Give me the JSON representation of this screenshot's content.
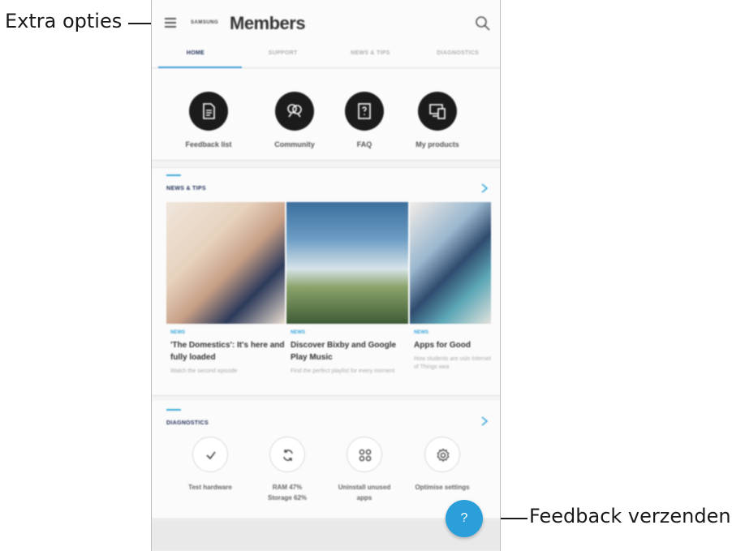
{
  "callouts": {
    "menu_label": "Extra opties",
    "feedback_label": "Feedback verzenden."
  },
  "header": {
    "brand_small": "SAMSUNG",
    "brand": "Members",
    "menu_icon": "hamburger-menu-icon",
    "search_icon": "search-icon"
  },
  "tabs": [
    {
      "label": "HOME",
      "active": true
    },
    {
      "label": "SUPPORT",
      "active": false
    },
    {
      "label": "NEWS & TIPS",
      "active": false
    },
    {
      "label": "DIAGNOSTICS",
      "active": false
    }
  ],
  "quick_actions": [
    {
      "label": "Feedback list",
      "icon": "document-icon"
    },
    {
      "label": "Community",
      "icon": "community-icon"
    },
    {
      "label": "FAQ",
      "icon": "faq-icon"
    },
    {
      "label": "My products",
      "icon": "devices-icon"
    }
  ],
  "news": {
    "title": "NEWS & TIPS",
    "items": [
      {
        "tag": "NEWS",
        "title": "'The Domestics': It's here and fully loaded",
        "subtitle": "Watch the second episode"
      },
      {
        "tag": "NEWS",
        "title": "Discover Bixby and Google Play Music",
        "subtitle": "Find the perfect playlist for every moment"
      },
      {
        "tag": "NEWS",
        "title": "Apps for Good",
        "subtitle": "How students are usin Internet of Things wea"
      }
    ]
  },
  "diagnostics": {
    "title": "DIAGNOSTICS",
    "items": [
      {
        "label": "Test hardware",
        "icon": "check-icon"
      },
      {
        "label": "RAM 47%\nStorage 62%",
        "icon": "refresh-icon"
      },
      {
        "label": "Uninstall unused\napps",
        "icon": "apps-grid-icon"
      },
      {
        "label": "Optimise settings",
        "icon": "settings-gear-icon"
      }
    ]
  },
  "fab": {
    "label": "?",
    "icon": "help-icon"
  },
  "colors": {
    "accent": "#3aa7d9",
    "fab": "#2b9fd9",
    "tab_active": "#1f2e58"
  }
}
